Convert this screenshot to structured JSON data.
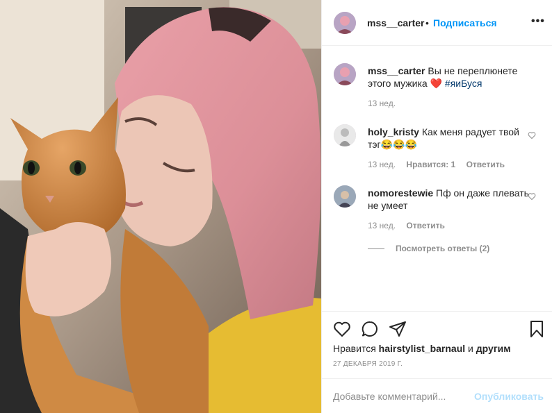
{
  "post": {
    "username": "mss__carter",
    "separator": "•",
    "follow_label": "Подписаться",
    "more_icon": "more-icon",
    "caption": {
      "username": "mss__carter",
      "text": " Вы не переплюнете этого мужика ❤️ ",
      "hashtag": "#яиБуся",
      "time": "13 нед."
    },
    "comments": [
      {
        "username": "holy_kristy",
        "text": " Как меня радует твой тэг😂😂😂",
        "time": "13 нед.",
        "likes": "Нравится: 1",
        "reply": "Ответить"
      },
      {
        "username": "nomorestewie",
        "text": " Пф он даже плевать не умеет",
        "time": "13 нед.",
        "reply": "Ответить"
      }
    ],
    "view_replies": "Посмотреть ответы (2)",
    "likes_prefix": "Нравится ",
    "likes_user": "hairstylist_barnaul",
    "likes_conj": " и ",
    "likes_others": "другим",
    "date": "27 ДЕКАБРЯ 2019 Г.",
    "comment_placeholder": "Добавьте комментарий...",
    "publish_label": "Опубликовать"
  },
  "colors": {
    "accent": "#0095f6",
    "publish_disabled": "#b2dffc",
    "hashtag": "#00376b",
    "muted": "#8e8e8e",
    "annotation": "#e8392a"
  }
}
